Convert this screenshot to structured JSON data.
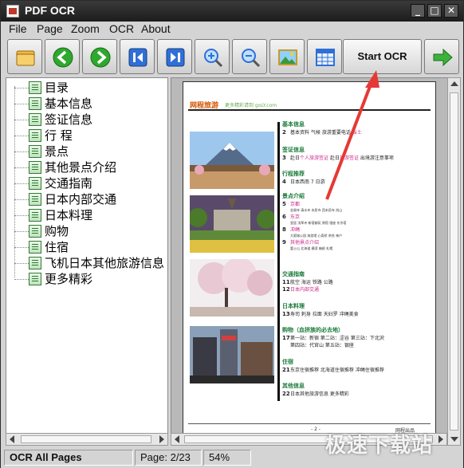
{
  "window": {
    "title": "PDF OCR",
    "controls": [
      "_",
      "□",
      "✕"
    ]
  },
  "menu": [
    "File",
    "Page",
    "Zoom",
    "OCR",
    "About"
  ],
  "toolbar": {
    "tools": [
      {
        "name": "open-folder-icon"
      },
      {
        "name": "previous-page-icon"
      },
      {
        "name": "next-page-icon"
      },
      {
        "name": "first-page-icon"
      },
      {
        "name": "last-page-icon"
      },
      {
        "name": "zoom-in-icon"
      },
      {
        "name": "zoom-out-icon"
      },
      {
        "name": "image-icon"
      },
      {
        "name": "grid-icon"
      }
    ],
    "start_ocr_label": "Start OCR",
    "run_icon": "arrow-right-icon"
  },
  "tree": {
    "items": [
      "目录",
      "基本信息",
      "签证信息",
      "行 程",
      "景点",
      "其他景点介绍",
      "交通指南",
      "日本内部交通",
      "日本料理",
      "购物",
      "住宿",
      "飞机日本其他旅游信息",
      "更多精彩"
    ]
  },
  "page": {
    "logo": "网程旅游",
    "logo_url": "更多精彩请到 goLY.com",
    "footer_left": "- 2 -",
    "footer_right": "网程出品",
    "toc": [
      {
        "heading": "基本信息",
        "rows": [
          {
            "n": "2",
            "text": "基本资料   气候   旅游重要电话   ",
            "pink": "当士"
          }
        ]
      },
      {
        "heading": "签证信息",
        "rows": [
          {
            "n": "3",
            "text": "赴日",
            "pink": "个人旅游签证",
            "text2": "  赴日",
            "pink2": "旅游签证",
            "text3": "  出境游注意事项"
          }
        ]
      },
      {
        "heading": "行程推荐",
        "rows": [
          {
            "n": "4",
            "text": "日本西南 7 日游"
          }
        ]
      },
      {
        "heading": "景点介绍",
        "rows": [
          {
            "n": "5",
            "pink": "京都",
            "sub": "金阁寺  清水寺  本愿寺  西本愿寺 岚山"
          },
          {
            "n": "6",
            "pink": "东京",
            "sub": "皇居  浅草寺  新宿御苑  原宿  银座  东京塔"
          },
          {
            "n": "8",
            "pink": "冲绳",
            "sub": "大阪城公园  海游馆  心斋桥  奈良  神户"
          },
          {
            "n": "9",
            "pink": "其他景点介绍",
            "sub": "富士山  北海道  横滨  箱根  札幌"
          }
        ]
      },
      {
        "heading": "交通指南",
        "rows": [
          {
            "n": "11",
            "text": "航空   海运   铁路   公路"
          },
          {
            "n": "12",
            "pink": "日本内部交通"
          }
        ]
      },
      {
        "heading": "日本料理",
        "rows": [
          {
            "n": "13",
            "text": "寿司   刺身   拉面   天妇罗   冲绳美食"
          }
        ]
      },
      {
        "heading": "购物（血拼族的必去地）",
        "rows": [
          {
            "n": "17",
            "text": "第一站：新宿  第二站：涩谷  第三站：下北沢"
          },
          {
            "n": "",
            "text": "第四站：代官山  第五站：银座"
          }
        ]
      },
      {
        "heading": "住宿",
        "rows": [
          {
            "n": "21",
            "text": "东京住宿推荐  北海道住宿推荐  冲绳住宿推荐"
          }
        ]
      },
      {
        "heading": "其他信息",
        "rows": [
          {
            "n": "22",
            "text": "日本其他旅游信息  更多精彩"
          }
        ]
      }
    ]
  },
  "status": {
    "mode": "OCR All Pages",
    "page": "Page: 2/23",
    "zoom": "54%"
  },
  "watermark": "极速下载站",
  "colors": {
    "titlebar": "#1c1c1c",
    "toolbar_green": "#2ea82e",
    "toolbar_blue": "#2f6fd6",
    "annotation": "#e53935"
  }
}
